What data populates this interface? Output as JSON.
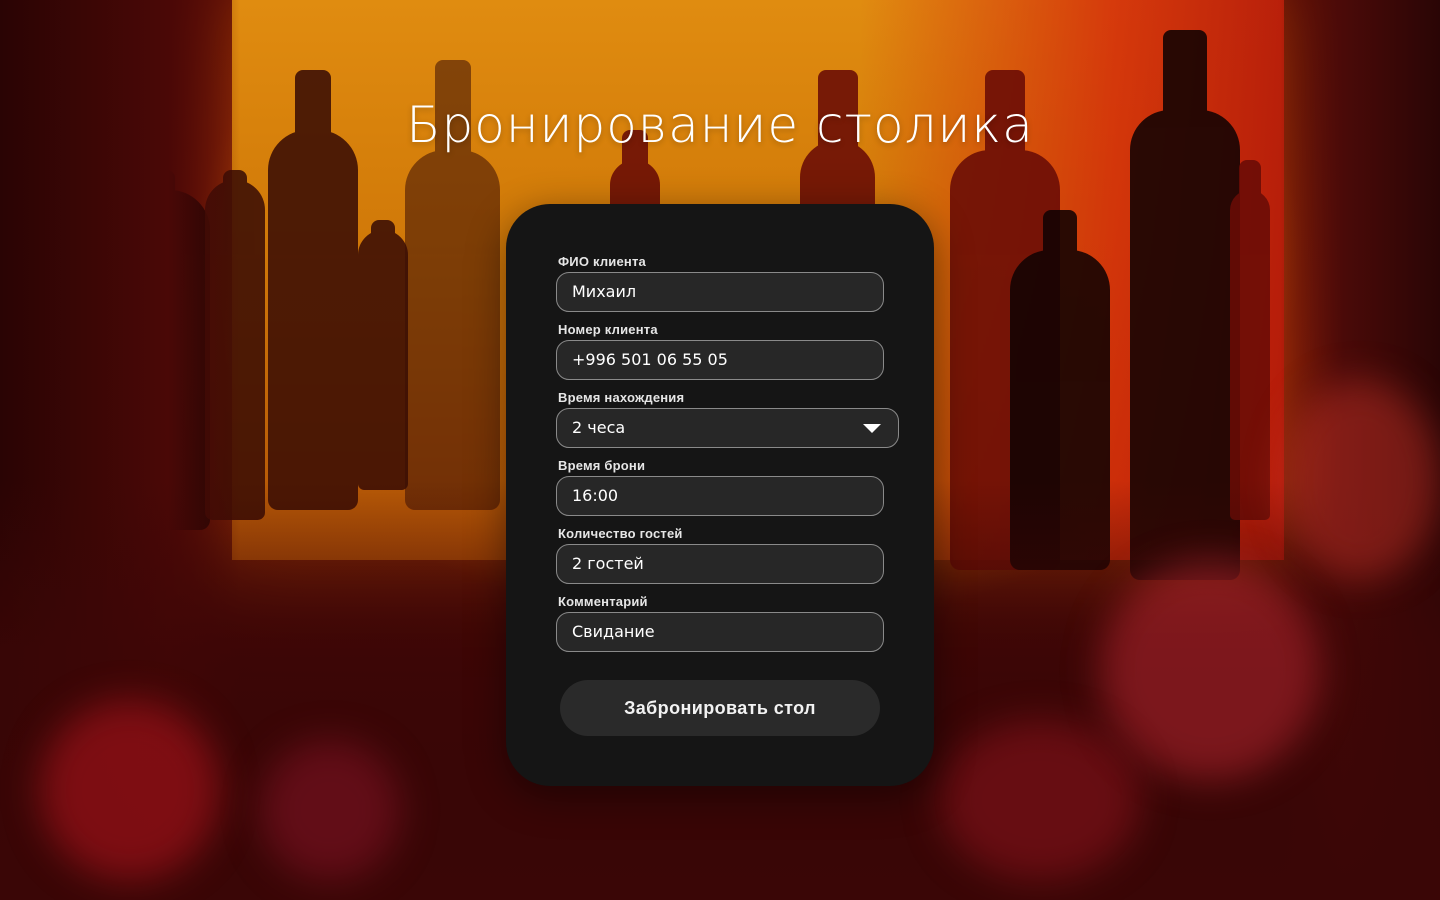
{
  "page": {
    "title": "Бронирование столика"
  },
  "form": {
    "fields": [
      {
        "label": "ФИО клиента",
        "value": "Михаил",
        "type": "text"
      },
      {
        "label": "Номер клиента",
        "value": "+996 501 06 55 05",
        "type": "text"
      },
      {
        "label": "Время нахождения",
        "value": "2 чеса",
        "type": "select",
        "icon": "chevron-down-icon"
      },
      {
        "label": "Время брони",
        "value": "16:00",
        "type": "text"
      },
      {
        "label": "Количество гостей",
        "value": "2 гостей",
        "type": "text"
      },
      {
        "label": "Комментарий",
        "value": "Свидание",
        "type": "text"
      }
    ],
    "submit_label": "Забронировать стол"
  },
  "colors": {
    "card_background": "#151515",
    "field_background": "#272727",
    "button_background": "#2a2a2a",
    "accent_glow": "#e08c10",
    "text": "#ffffff"
  }
}
